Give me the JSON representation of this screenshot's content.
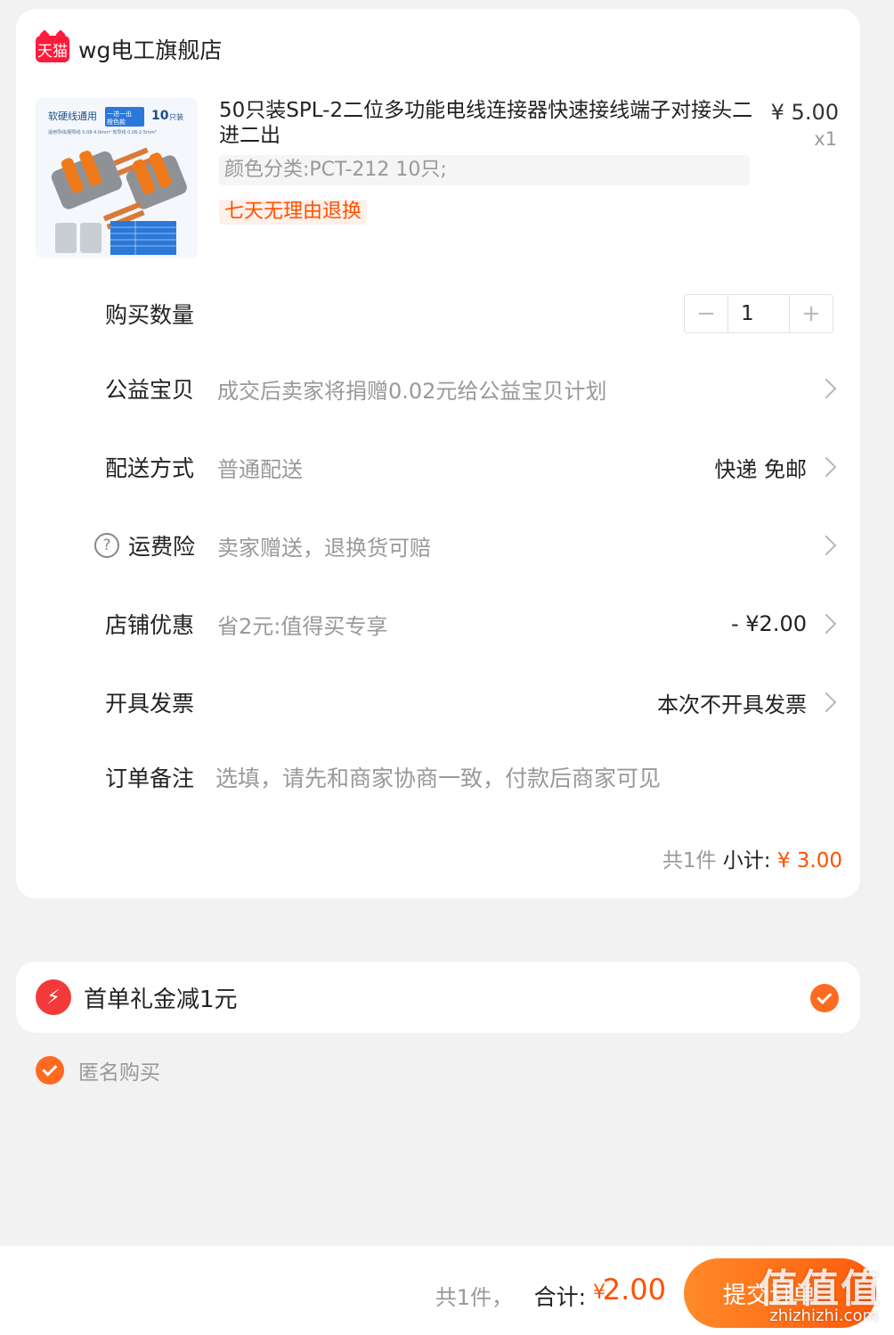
{
  "shop": {
    "logo_text": "天猫",
    "name": "wg电工旗舰店"
  },
  "product": {
    "title": "50只装SPL-2二位多功能电线连接器快速接线端子对接头二进二出",
    "price": "¥ 5.00",
    "quantity_mult": "x1",
    "sku": "颜色分类:PCT-212 10只;",
    "tag": "七天无理由退换",
    "image_text": {
      "top_left": "软硬线通用",
      "badge": "一进一出 橙色款",
      "pack": "10只装",
      "spec": "适用导线/硬导线 0.08-4.0mm²  软导线 0.08-2.5mm²"
    }
  },
  "quantity": {
    "label": "购买数量",
    "value": "1",
    "minus": "−",
    "plus": "+"
  },
  "charity": {
    "label": "公益宝贝",
    "desc": "成交后卖家将捐赠0.02元给公益宝贝计划"
  },
  "delivery": {
    "label": "配送方式",
    "desc": "普通配送",
    "value": "快递 免邮"
  },
  "insurance": {
    "label": "运费险",
    "desc": "卖家赠送，退换货可赔",
    "help": "?"
  },
  "discount": {
    "label": "店铺优惠",
    "desc": "省2元:值得买专享",
    "value": "- ¥2.00"
  },
  "invoice": {
    "label": "开具发票",
    "value": "本次不开具发票"
  },
  "note": {
    "label": "订单备注",
    "placeholder": "选填，请先和商家协商一致，付款后商家可见"
  },
  "subtotal": {
    "count": "共1件",
    "label": "小计:",
    "amount": "¥ 3.00"
  },
  "gift": {
    "text": "首单礼金减1元",
    "checked": true
  },
  "anonymous": {
    "label": "匿名购买",
    "checked": true
  },
  "bottom": {
    "count": "共1件，",
    "total_label": "合计:",
    "yen": "¥",
    "amount": "2.00",
    "submit": "提交订单"
  },
  "watermark": {
    "logo": "值值值",
    "url": "zhizhizhi.com"
  },
  "colors": {
    "accent": "#ff5000",
    "tmall_red": "#ff1a3c",
    "bg": "#f2f2f2"
  }
}
